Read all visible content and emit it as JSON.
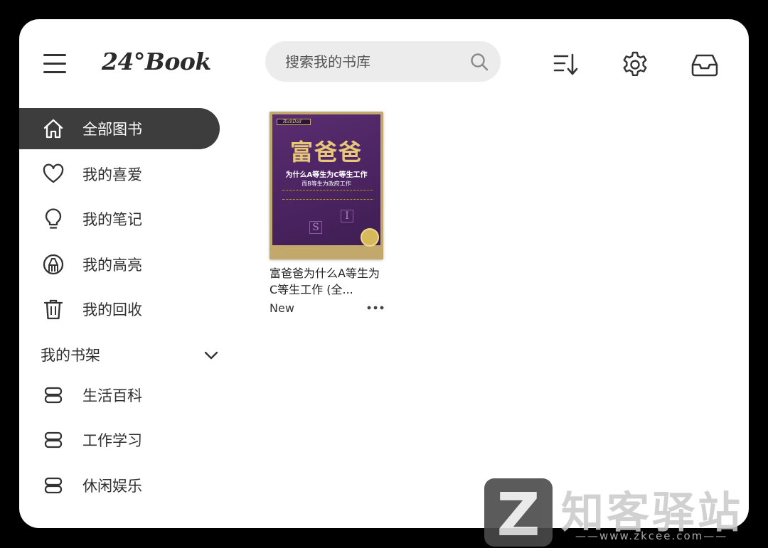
{
  "header": {
    "logo_text": "24°Book",
    "search": {
      "placeholder": "搜索我的书库"
    }
  },
  "sidebar": {
    "items": [
      {
        "label": "全部图书",
        "icon": "home-icon",
        "active": true
      },
      {
        "label": "我的喜爱",
        "icon": "heart-icon",
        "active": false
      },
      {
        "label": "我的笔记",
        "icon": "lightbulb-icon",
        "active": false
      },
      {
        "label": "我的高亮",
        "icon": "highlighter-icon",
        "active": false
      },
      {
        "label": "我的回收",
        "icon": "trash-icon",
        "active": false
      }
    ],
    "shelf_header": "我的书架",
    "shelves": [
      {
        "label": "生活百科",
        "icon": "shelf-icon"
      },
      {
        "label": "工作学习",
        "icon": "shelf-icon"
      },
      {
        "label": "休闲娱乐",
        "icon": "shelf-icon"
      }
    ]
  },
  "books": [
    {
      "title": "富爸爸为什么A等生为C等生工作 (全...",
      "status": "New",
      "cover": {
        "brand": "RichDad",
        "big_title": "富爸爸",
        "subtitle_1": "为什么A等生为C等生工作",
        "subtitle_2": "而B等生为政府工作"
      }
    }
  ],
  "watermark": {
    "z": "Z",
    "text": "知客驿站",
    "url": "——www.zkcee.com——"
  },
  "colors": {
    "active_bg": "#3d3d3d",
    "search_bg": "#ececec",
    "text": "#2f2f2f"
  }
}
